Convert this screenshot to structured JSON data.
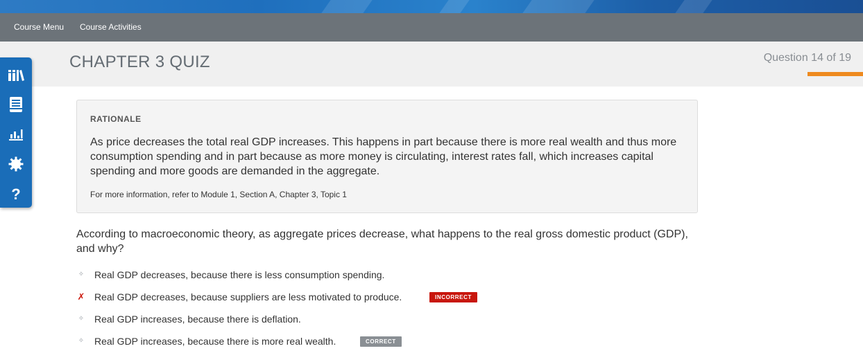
{
  "nav": {
    "course_menu": "Course Menu",
    "course_activities": "Course Activities"
  },
  "header": {
    "title": "CHAPTER 3 QUIZ",
    "question_counter": "Question 14 of 19",
    "progress": {
      "current": 14,
      "total": 19
    }
  },
  "toolbar": {
    "icons": [
      "library-icon",
      "notebook-icon",
      "bar-chart-icon",
      "settings-gear-icon",
      "help-question-icon"
    ]
  },
  "rationale": {
    "heading": "RATIONALE",
    "body": "As price decreases the total real GDP increases. This happens in part because there is more real wealth and thus more consumption spending and in part because as more money is circulating, interest rates fall, which increases capital spending and more goods are demanded in the aggregate.",
    "reference": "For more information, refer to Module 1, Section A, Chapter 3, Topic 1"
  },
  "question": {
    "text": "According to macroeconomic theory, as aggregate prices decrease, what happens to the real gross domestic product (GDP), and why?"
  },
  "answers": [
    {
      "text": "Real GDP decreases, because there is less consumption spending.",
      "marker": "✧",
      "badge": ""
    },
    {
      "text": "Real GDP decreases, because suppliers are less motivated to produce.",
      "marker": "✗",
      "badge": "INCORRECT"
    },
    {
      "text": "Real GDP increases, because there is deflation.",
      "marker": "✧",
      "badge": ""
    },
    {
      "text": "Real GDP increases, because there is more real wealth.",
      "marker": "✧",
      "badge": "CORRECT"
    }
  ],
  "colors": {
    "toolbar": "#1a6db8",
    "navbar": "#6c7379",
    "progress": "#ee8a1f",
    "incorrect": "#c8170d",
    "correct": "#8a8f94"
  }
}
